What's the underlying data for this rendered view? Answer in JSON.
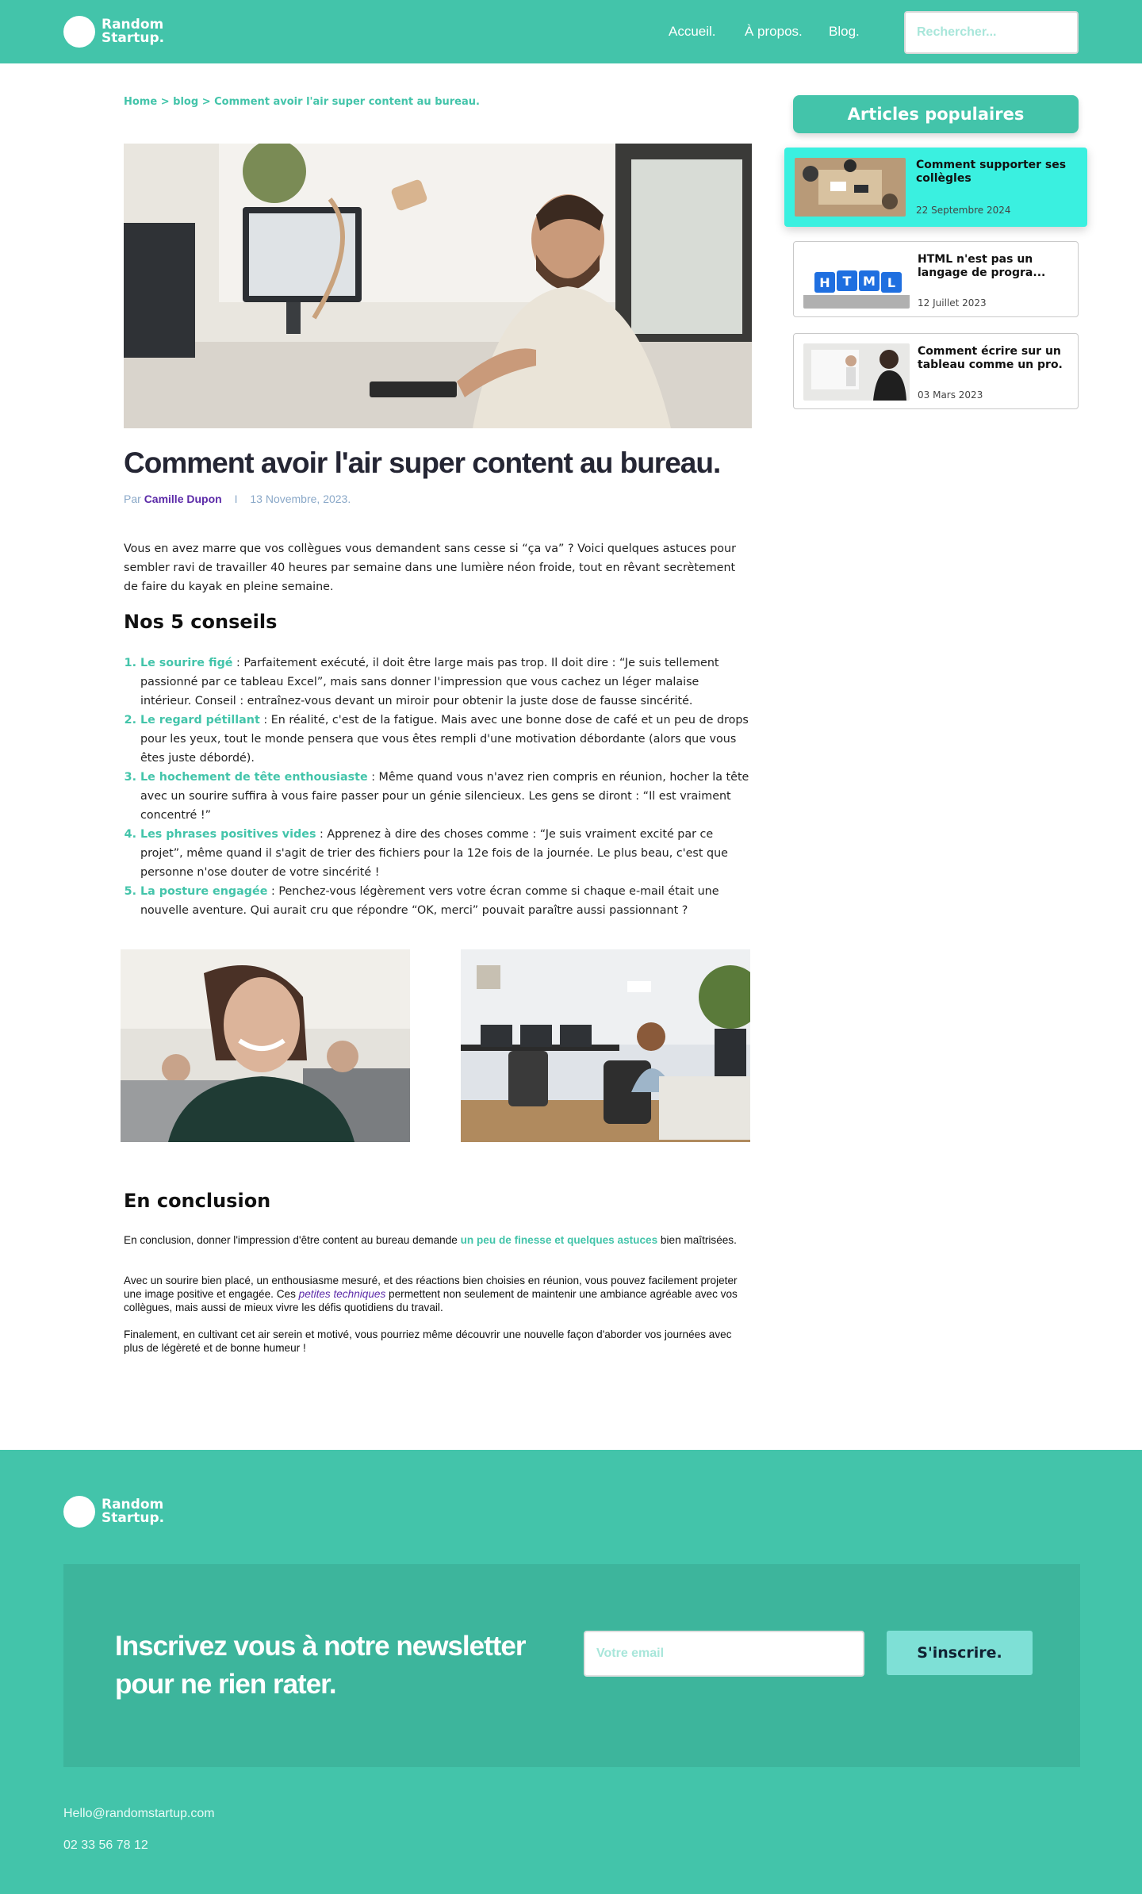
{
  "header": {
    "logo_line1": "Random",
    "logo_line2": "Startup.",
    "nav": [
      "Accueil.",
      "À propos.",
      "Blog."
    ],
    "search_placeholder": "Rechercher..."
  },
  "breadcrumb": {
    "home": "Home",
    "sep": ">",
    "blog": "blog",
    "current": "Comment avoir l'air super content au bureau."
  },
  "article": {
    "title": "Comment avoir l'air super content au bureau.",
    "by": "Par",
    "author": "Camille Dupon",
    "sep": "I",
    "date": "13 Novembre, 2023.",
    "intro": "Vous en avez marre que vos collègues vous demandent sans cesse si “ça va” ? Voici quelques astuces pour sembler ravi de travailler 40 heures par semaine dans une lumière néon froide, tout en rêvant secrètement de faire du kayak en pleine semaine.",
    "tips_heading": "Nos 5 conseils",
    "tips": [
      {
        "name": "Le sourire figé",
        "text": " : Parfaitement exécuté, il doit être large mais pas trop. Il doit dire : “Je suis tellement passionné par ce tableau Excel”, mais sans donner l'impression que vous cachez un léger malaise intérieur. Conseil : entraînez-vous devant un miroir pour obtenir la juste dose de fausse sincérité."
      },
      {
        "name": "Le regard pétillant",
        "text": " : En réalité, c'est de la fatigue. Mais avec une bonne dose de café et un peu de drops pour les yeux, tout le monde pensera que vous êtes rempli d'une motivation débordante (alors que vous êtes juste débordé)."
      },
      {
        "name": "Le hochement de tête enthousiaste",
        "text": " : Même quand vous n'avez rien compris en réunion, hocher la tête avec un sourire suffira à vous faire passer pour un génie silencieux. Les gens se diront : “Il est vraiment concentré !”"
      },
      {
        "name": "Les phrases positives vides",
        "text": " : Apprenez à dire des choses comme : “Je suis vraiment excité par ce projet”, même quand il s'agit de trier des fichiers pour la 12e fois de la journée. Le plus beau, c'est que personne n'ose douter de votre sincérité !"
      },
      {
        "name": "La posture engagée",
        "text": " : Penchez-vous légèrement vers votre écran comme si chaque e-mail était une nouvelle aventure. Qui aurait cru que répondre “OK, merci” pouvait paraître aussi passionnant ?"
      }
    ],
    "conclusion_heading": "En conclusion",
    "concl_p1_a": "En conclusion, donner l'impression d'être content au bureau demande ",
    "concl_p1_link": "un peu de finesse et quelques astuces",
    "concl_p1_b": " bien maîtrisées.",
    "concl_p2_a": "Avec un sourire bien placé, un enthousiasme mesuré, et des réactions bien choisies en réunion, vous pouvez facilement projeter une image positive et engagée. Ces ",
    "concl_p2_link": "petites techniques",
    "concl_p2_b": " permettent non seulement de maintenir une ambiance agréable avec vos collègues, mais aussi de mieux vivre les défis quotidiens du travail.",
    "concl_p3": "Finalement, en cultivant cet air serein et motivé, vous pourriez même découvrir une nouvelle façon d'aborder vos journées avec plus de légèreté et de bonne humeur !"
  },
  "sidebar": {
    "title": "Articles populaires",
    "cards": [
      {
        "title": "Comment supporter ses collègles",
        "date": "22 Septembre 2024"
      },
      {
        "title": "HTML n'est pas un langage de progra...",
        "date": "12 Juillet 2023"
      },
      {
        "title": "Comment écrire sur un tableau comme un pro.",
        "date": "03 Mars 2023"
      }
    ],
    "html_cubes": [
      "H",
      "T",
      "M",
      "L"
    ]
  },
  "footer": {
    "logo_line1": "Random",
    "logo_line2": "Startup.",
    "newsletter_title": "Inscrivez vous à notre newsletter pour ne rien rater.",
    "email_placeholder": "Votre email",
    "subscribe_label": "S'inscrire.",
    "email": "Hello@randomstartup.com",
    "phone": "02 33 56 78 12"
  },
  "colors": {
    "brand": "#43c4aa",
    "active_card": "#3af0e0",
    "author": "#5b2aa8"
  }
}
